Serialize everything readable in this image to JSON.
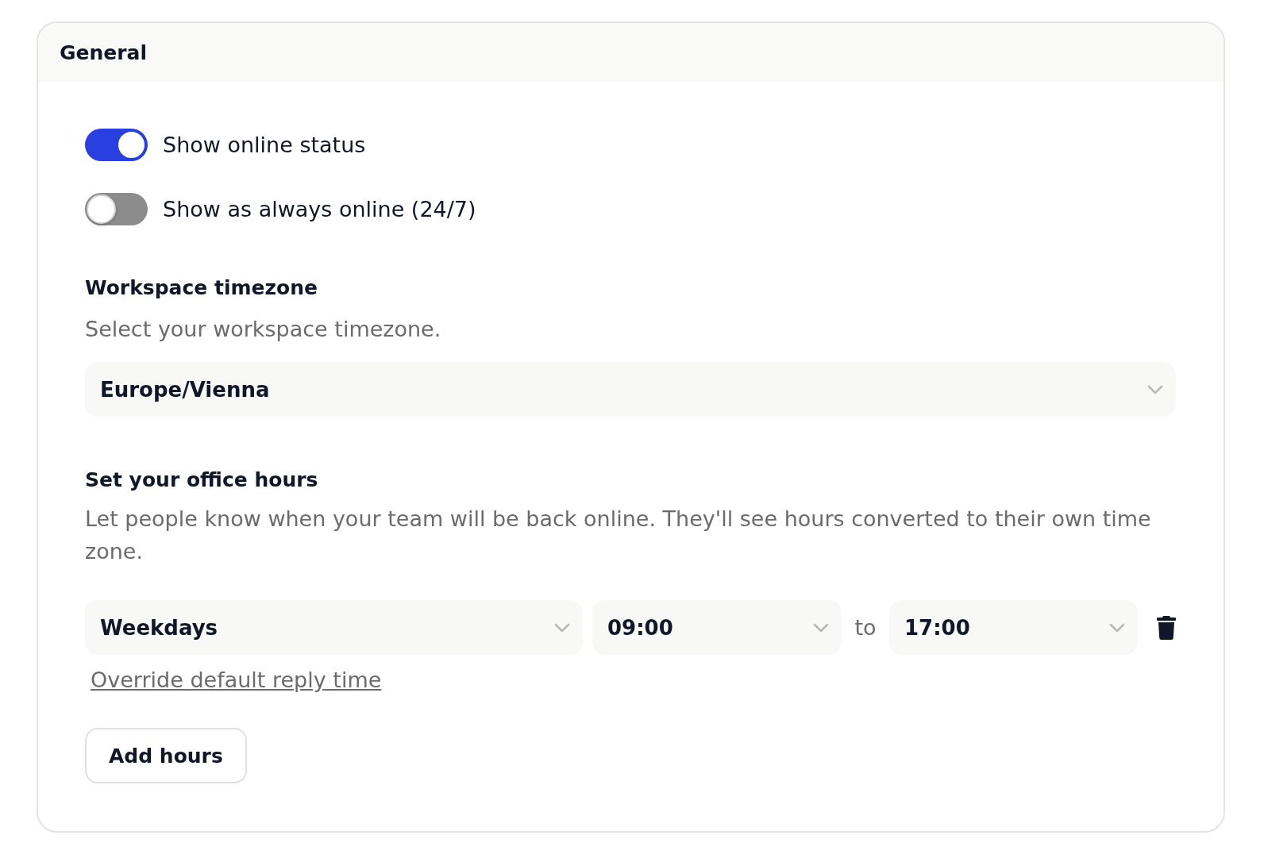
{
  "panel": {
    "title": "General"
  },
  "toggles": [
    {
      "label": "Show online status",
      "on": true
    },
    {
      "label": "Show as always online (24/7)",
      "on": false
    }
  ],
  "timezone": {
    "heading": "Workspace timezone",
    "description": "Select your workspace timezone.",
    "select": {
      "value": "Europe/Vienna"
    }
  },
  "office_hours": {
    "heading": "Set your office hours",
    "description": "Let people know when your team will be back online. They'll see hours converted to their own time zone.",
    "rows": [
      {
        "days": "Weekdays",
        "start": "09:00",
        "separator": "to",
        "end": "17:00"
      }
    ],
    "link": "Override default reply time",
    "add_button": "Add hours"
  }
}
